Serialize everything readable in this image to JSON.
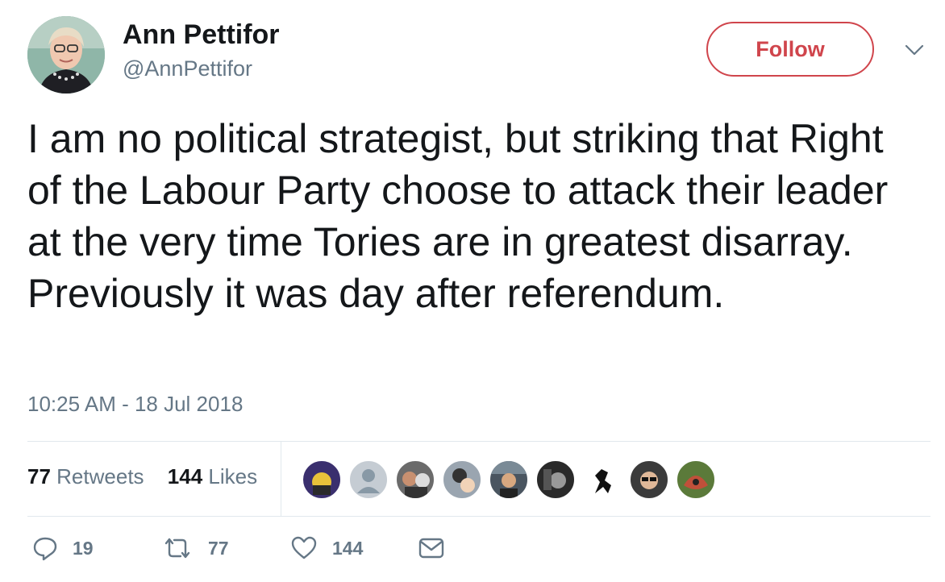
{
  "author": {
    "name": "Ann Pettifor",
    "handle": "@AnnPettifor"
  },
  "follow_label": "Follow",
  "tweet": {
    "text": "I am no political strategist, but striking that Right of the Labour Party choose to attack their leader at the very time Tories are in greatest disarray. Previously it was day after referendum.",
    "timestamp": "10:25 AM - 18 Jul 2018"
  },
  "stats": {
    "retweets_count": "77",
    "retweets_label": "Retweets",
    "likes_count": "144",
    "likes_label": "Likes"
  },
  "actions": {
    "replies": "19",
    "retweets": "77",
    "likes": "144"
  },
  "colors": {
    "follow_accent": "#d0454c",
    "secondary_text": "#657786",
    "divider": "#e1e8ed"
  },
  "icons": [
    "chevron-down-icon",
    "reply-icon",
    "retweet-icon",
    "heart-icon",
    "envelope-icon"
  ]
}
